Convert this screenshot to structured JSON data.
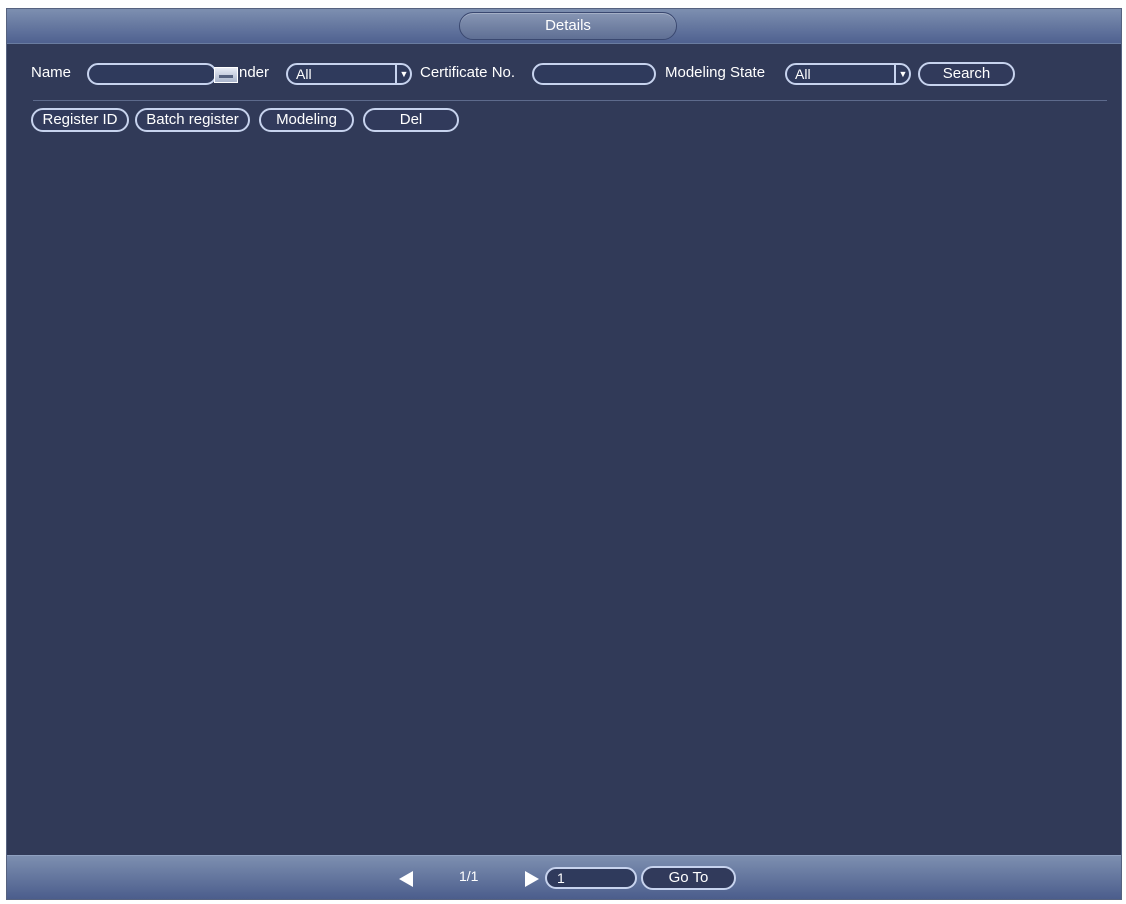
{
  "window": {
    "title": "Details"
  },
  "filters": {
    "name_label": "Name",
    "name_value": "",
    "gender_label": "nder",
    "gender_value": "All",
    "certificate_label": "Certificate No.",
    "certificate_value": "",
    "modeling_state_label": "Modeling State",
    "modeling_state_value": "All",
    "search_label": "Search"
  },
  "actions": {
    "register_id": "Register ID",
    "batch_register": "Batch register",
    "modeling": "Modeling",
    "del": "Del"
  },
  "footer": {
    "page_indicator": "1/1",
    "page_input_value": "1",
    "goto_label": "Go To"
  },
  "icons": {
    "keyboard": "keyboard-icon",
    "prev": "prev-page-icon",
    "next": "next-page-icon",
    "dropdown": "chevron-down-icon"
  },
  "colors": {
    "background": "#313a58",
    "titlebar": "#5f6f94",
    "control_border": "#c7d3ee"
  }
}
